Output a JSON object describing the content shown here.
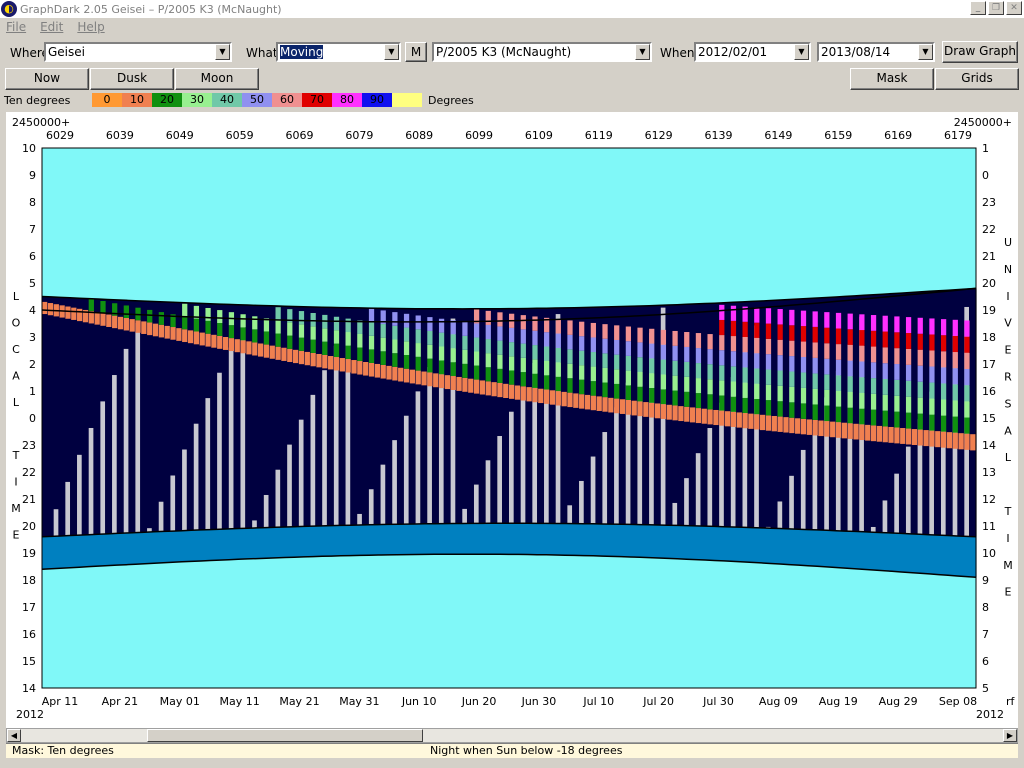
{
  "window": {
    "title": "GraphDark 2.05   Geisei  –  P/2005 K3 (McNaught)",
    "app_icon": "owl-icon"
  },
  "menu": [
    "File",
    "Edit",
    "Help"
  ],
  "toolbar": {
    "where_label": "Where",
    "where_value": "Geisei",
    "what_label": "What",
    "what_value": "Moving",
    "m_button": "M",
    "object_value": "P/2005 K3 (McNaught)",
    "when_label": "When",
    "start_date": "2012/02/01",
    "end_date": "2013/08/14",
    "draw_button": "Draw Graph"
  },
  "row2": {
    "now": "Now",
    "dusk": "Dusk",
    "moon": "Moon",
    "mask": "Mask",
    "grids": "Grids"
  },
  "legend": {
    "label": "Ten degrees",
    "unit": "Degrees",
    "items": [
      {
        "t": "0",
        "c": "#ff9933"
      },
      {
        "t": "10",
        "c": "#f08050"
      },
      {
        "t": "20",
        "c": "#109010"
      },
      {
        "t": "30",
        "c": "#98f090"
      },
      {
        "t": "40",
        "c": "#70c8a8"
      },
      {
        "t": "50",
        "c": "#9090f0"
      },
      {
        "t": "60",
        "c": "#f09090"
      },
      {
        "t": "70",
        "c": "#e00000"
      },
      {
        "t": "80",
        "c": "#ff30ff"
      },
      {
        "t": "90",
        "c": "#1010f0"
      },
      {
        "t": "",
        "c": "#ffff80"
      }
    ]
  },
  "chart_data": {
    "type": "heatmap",
    "jd_prefix_left": "2450000+",
    "jd_prefix_right": "2450000+",
    "jd_ticks": [
      "6029",
      "6039",
      "6049",
      "6059",
      "6069",
      "6079",
      "6089",
      "6099",
      "6109",
      "6119",
      "6129",
      "6139",
      "6149",
      "6159",
      "6169",
      "6179"
    ],
    "date_ticks": [
      "Apr 11",
      "Apr 21",
      "May 01",
      "May 11",
      "May 21",
      "May 31",
      "Jun 10",
      "Jun 20",
      "Jun 30",
      "Jul 10",
      "Jul 20",
      "Jul 30",
      "Aug 09",
      "Aug 19",
      "Aug 29",
      "Sep 08"
    ],
    "year_left": "2012",
    "year_right": "2012",
    "left_axis_label": "LOCAL TIME",
    "left_ticks": [
      "10",
      "9",
      "8",
      "7",
      "6",
      "5",
      "4",
      "3",
      "2",
      "1",
      "0",
      "23",
      "22",
      "21",
      "20",
      "19",
      "18",
      "17",
      "16",
      "15",
      "14"
    ],
    "right_axis_label": "UNIVERSAL TIME",
    "right_ticks": [
      "1",
      "0",
      "23",
      "22",
      "21",
      "20",
      "19",
      "18",
      "17",
      "16",
      "15",
      "14",
      "13",
      "12",
      "11",
      "10",
      "9",
      "8",
      "7",
      "6",
      "5"
    ],
    "right_footer": "rf",
    "colors": {
      "day": "#80f8f8",
      "twilight": "#0080c0",
      "night": "#000040",
      "moonlit": "#c8c8d0"
    }
  },
  "status": {
    "mask": "Mask:  Ten degrees",
    "night": "Night when Sun below -18 degrees"
  }
}
